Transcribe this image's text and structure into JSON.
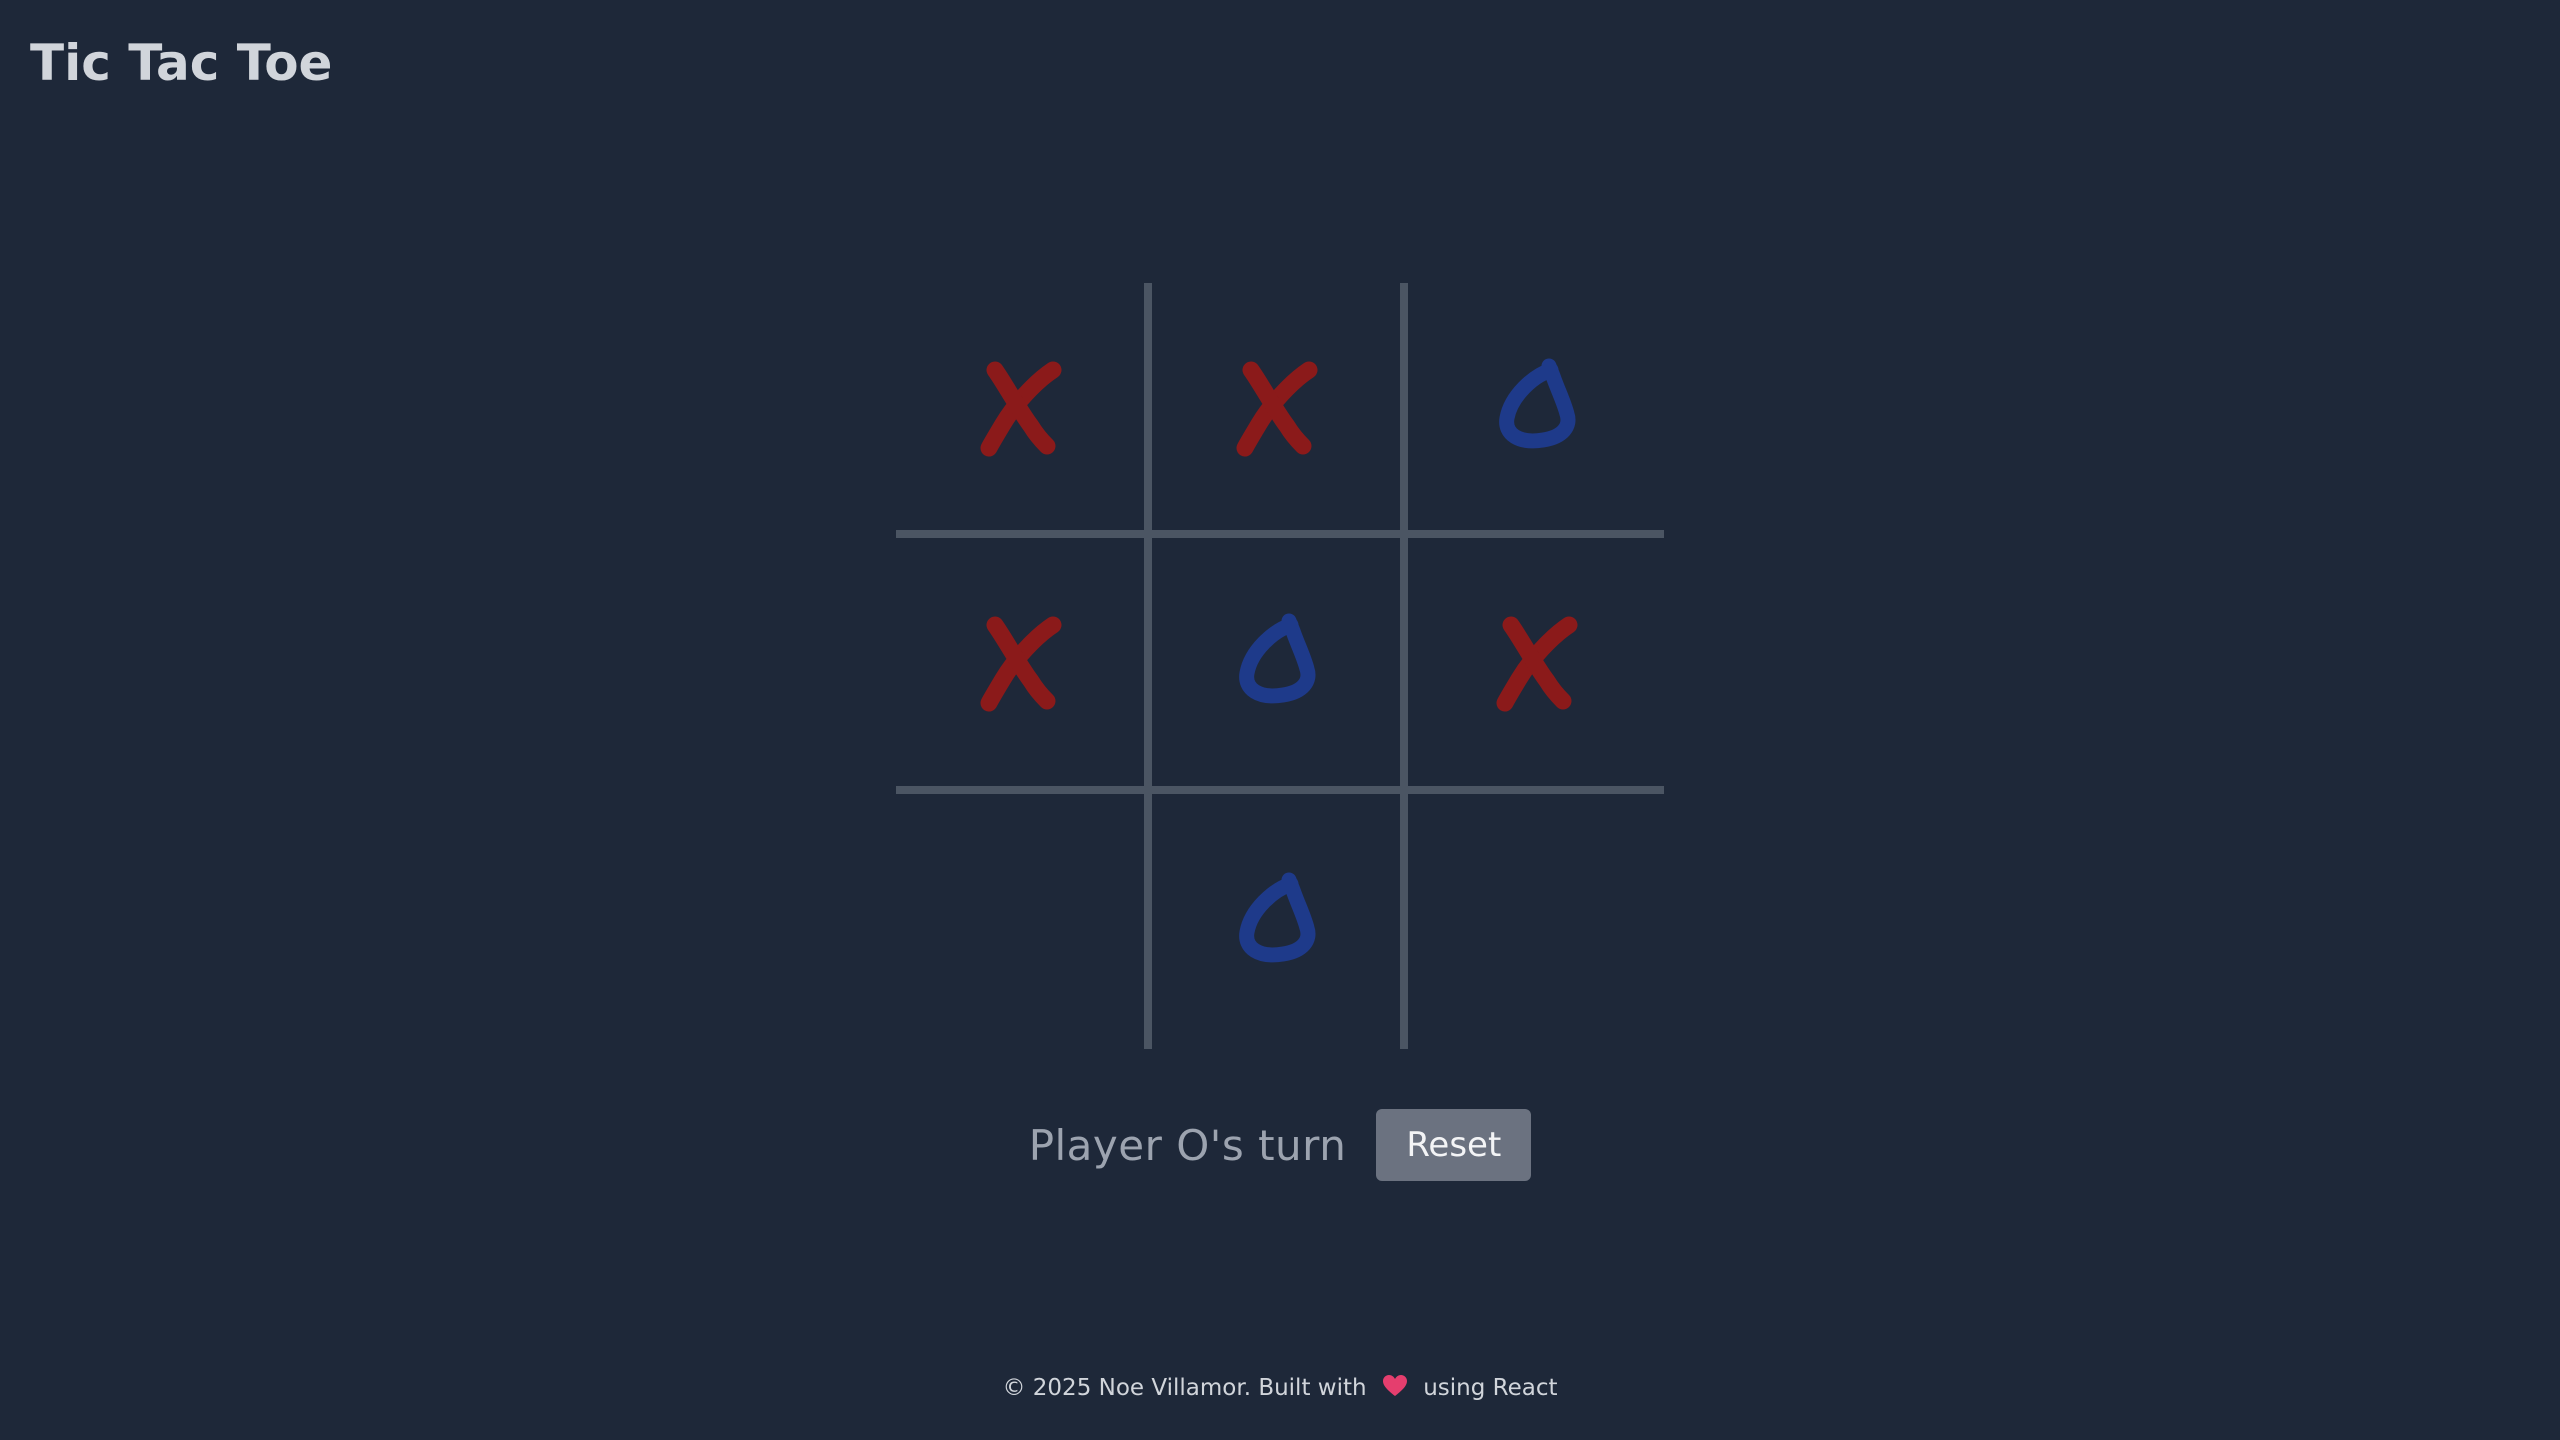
{
  "app": {
    "title": "Tic Tac Toe"
  },
  "colors": {
    "background": "#1e2839",
    "grid_line": "#4b5563",
    "x_mark": "#8b1a1a",
    "o_mark": "#1e3a8a",
    "heart": "#e53e6e",
    "reset_button": "#6b7280"
  },
  "board": {
    "cells": [
      "X",
      "X",
      "O",
      "X",
      "O",
      "X",
      "",
      "O",
      ""
    ]
  },
  "status": {
    "text": "Player O's turn"
  },
  "controls": {
    "reset_label": "Reset"
  },
  "footer": {
    "prefix": "© 2025 Noe Villamor. Built with",
    "heart_icon": "heart-icon",
    "suffix": "using React"
  }
}
